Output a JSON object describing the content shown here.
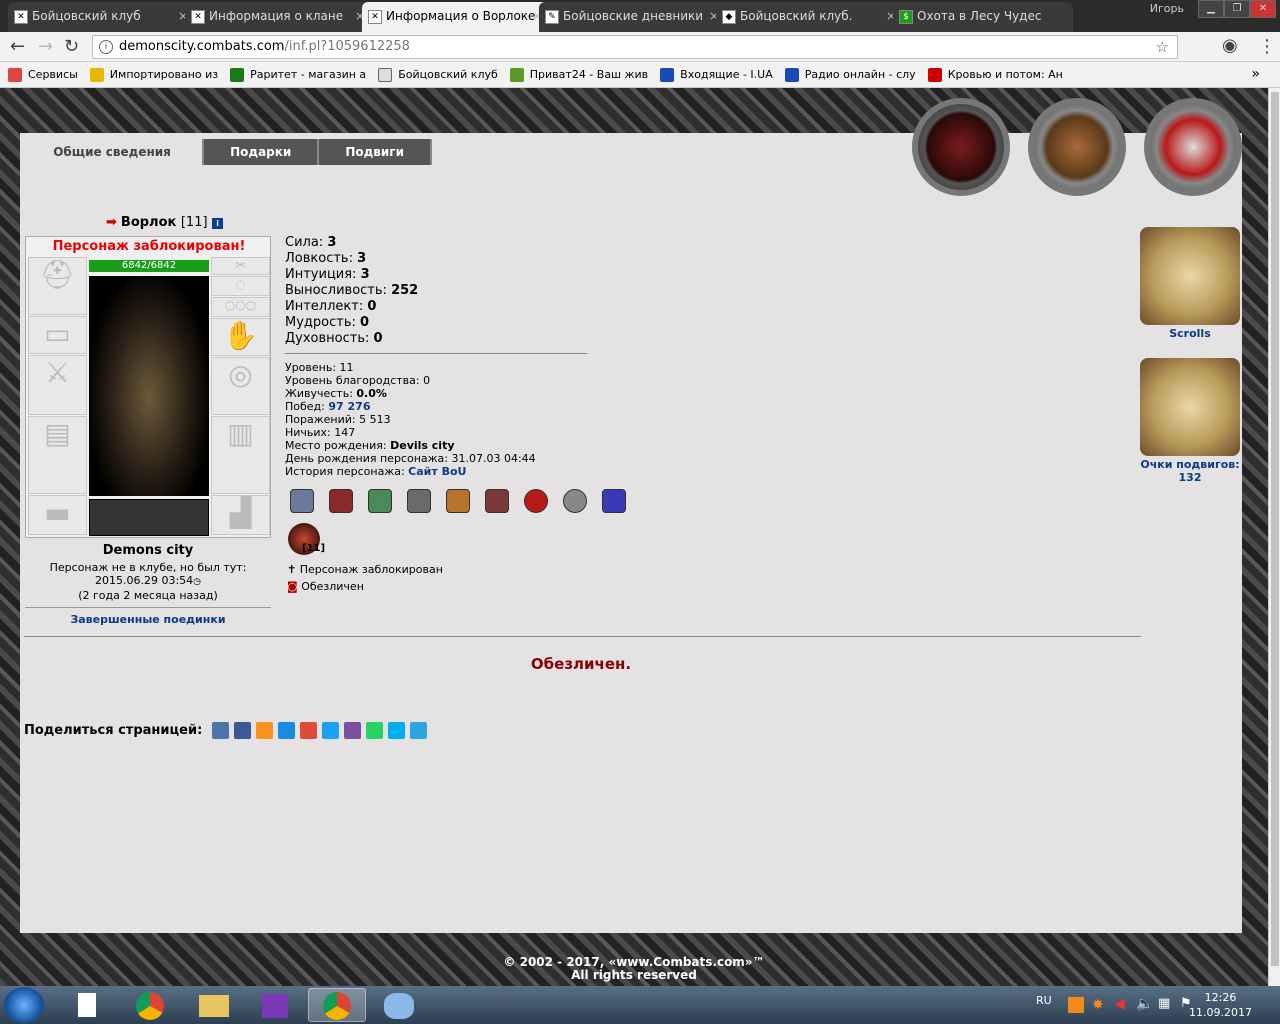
{
  "browser": {
    "tabs": [
      {
        "label": "Бойцовский клуб"
      },
      {
        "label": "Информация о клане"
      },
      {
        "label": "Информация о Ворлоке"
      },
      {
        "label": "Бойцовские дневники"
      },
      {
        "label": "Бойцовский клуб."
      },
      {
        "label": "Охота в Лесу Чудес"
      }
    ],
    "user": "Игорь",
    "url_host": "demonscity.combats.com",
    "url_path": "/inf.pl?1059612258",
    "bookmarks": [
      {
        "label": "Сервисы",
        "color": "#d44"
      },
      {
        "label": "Импортировано из",
        "color": "#e8b800"
      },
      {
        "label": "Раритет - магазин а",
        "color": "#1a7a1a"
      },
      {
        "label": "Бойцовский клуб",
        "color": "#ddd"
      },
      {
        "label": "Приват24 - Ваш жив",
        "color": "#5a9a2a"
      },
      {
        "label": "Входящие - I.UA",
        "color": "#1a4ab8"
      },
      {
        "label": "Радио онлайн - слу",
        "color": "#1a4ab8"
      },
      {
        "label": "Кровью и потом: Ан",
        "color": "#c00"
      }
    ]
  },
  "page": {
    "tabs": [
      "Общие сведения",
      "Подарки",
      "Подвиги"
    ],
    "char_name": "Ворлок",
    "char_level": "[11]",
    "blocked_banner": "Персонаж заблокирован!",
    "hp": "6842/6842",
    "city": "Demons city",
    "last_seen_line1": "Персонаж не в клубе, но был тут:",
    "last_seen_date": "2015.06.29 03:54",
    "last_seen_ago": "(2 года 2 месяца назад)",
    "finished_duels": "Завершенные поединки",
    "stats": [
      {
        "label": "Сила:",
        "value": "3"
      },
      {
        "label": "Ловкость:",
        "value": "3"
      },
      {
        "label": "Интуиция:",
        "value": "3"
      },
      {
        "label": "Выносливость:",
        "value": "252"
      },
      {
        "label": "Интеллект:",
        "value": "0"
      },
      {
        "label": "Мудрость:",
        "value": "0"
      },
      {
        "label": "Духовность:",
        "value": "0"
      }
    ],
    "info": {
      "level_label": "Уровень:",
      "level": "11",
      "nobility_label": "Уровень благородства:",
      "nobility": "0",
      "vitality_label": "Живучесть:",
      "vitality": "0.0%",
      "wins_label": "Побед:",
      "wins": "97 276",
      "losses_label": "Поражений:",
      "losses": "5 513",
      "draws_label": "Ничьих:",
      "draws": "147",
      "birthplace_label": "Место рождения:",
      "birthplace": "Devils city",
      "birthday_label": "День рождения персонажа:",
      "birthday": "31.07.03 04:44",
      "history_label": "История персонажа:",
      "history": "Сайт BoU"
    },
    "leader_level": "[11]",
    "status_blocked": "Персонаж заблокирован",
    "status_faceless": "Обезличен",
    "faceless_banner": "Обезличен.",
    "share_label": "Поделиться страницей:",
    "share_colors": [
      "#4a76a8",
      "#3b5998",
      "#f7931e",
      "#168de2",
      "#dd4b39",
      "#1da1f2",
      "#7b519d",
      "#25d366",
      "#00aff0",
      "#2ca5e0"
    ],
    "side": {
      "scrolls": "Scrolls",
      "feats_label": "Очки подвигов:",
      "feats_value": "132"
    },
    "footer_line1": "© 2002 - 2017, «www.Combats.com»™",
    "footer_line2": "All rights reserved"
  },
  "taskbar": {
    "lang": "RU",
    "time": "12:26",
    "date": "11.09.2017"
  }
}
